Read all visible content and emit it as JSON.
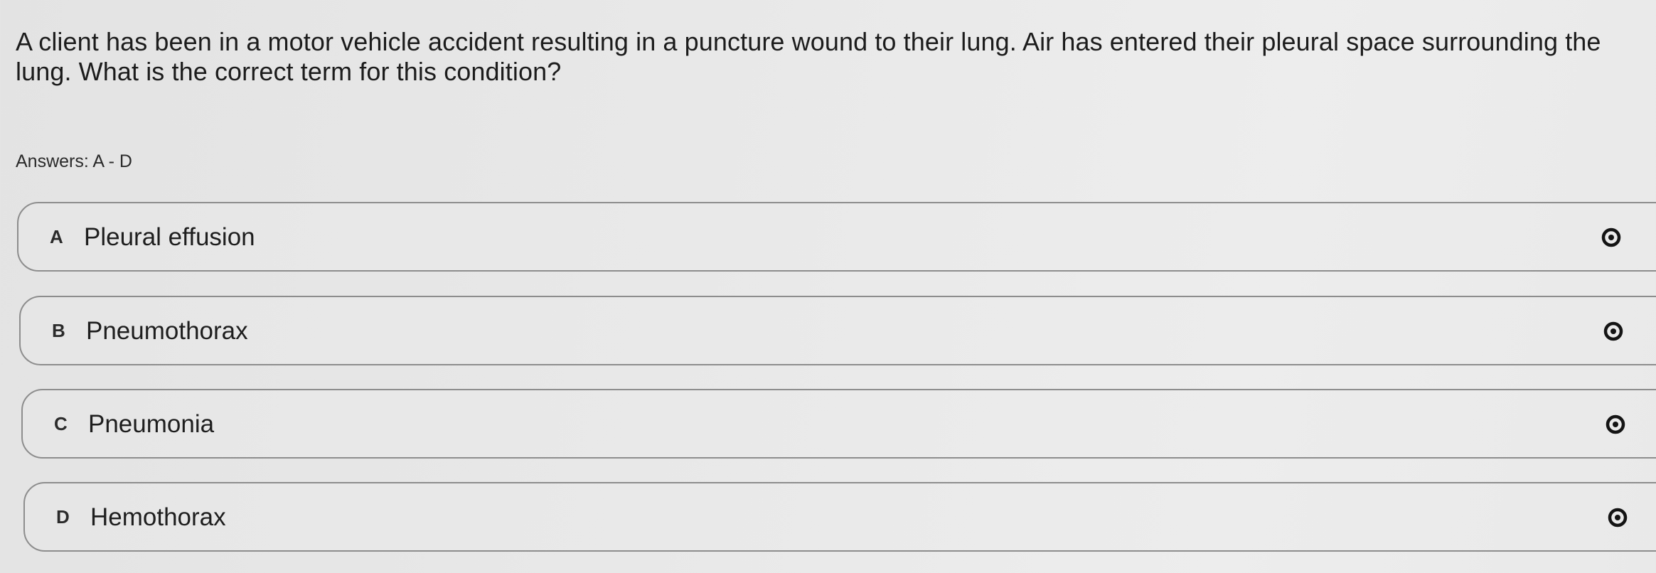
{
  "question": {
    "text": "A client has been in a motor vehicle accident resulting in a puncture wound to their lung. Air has entered their pleural space surrounding the lung. What is the correct term for this condition?"
  },
  "answers_label": "Answers: A - D",
  "options": [
    {
      "letter": "A",
      "text": "Pleural effusion",
      "icon": "eye-icon"
    },
    {
      "letter": "B",
      "text": "Pneumothorax",
      "icon": "eye-icon"
    },
    {
      "letter": "C",
      "text": "Pneumonia",
      "icon": "eye-icon"
    },
    {
      "letter": "D",
      "text": "Hemothorax",
      "icon": "eye-icon"
    }
  ],
  "colors": {
    "border": "#8d8d8d",
    "text": "#1c1c1c",
    "background": "#e8e8e8"
  }
}
